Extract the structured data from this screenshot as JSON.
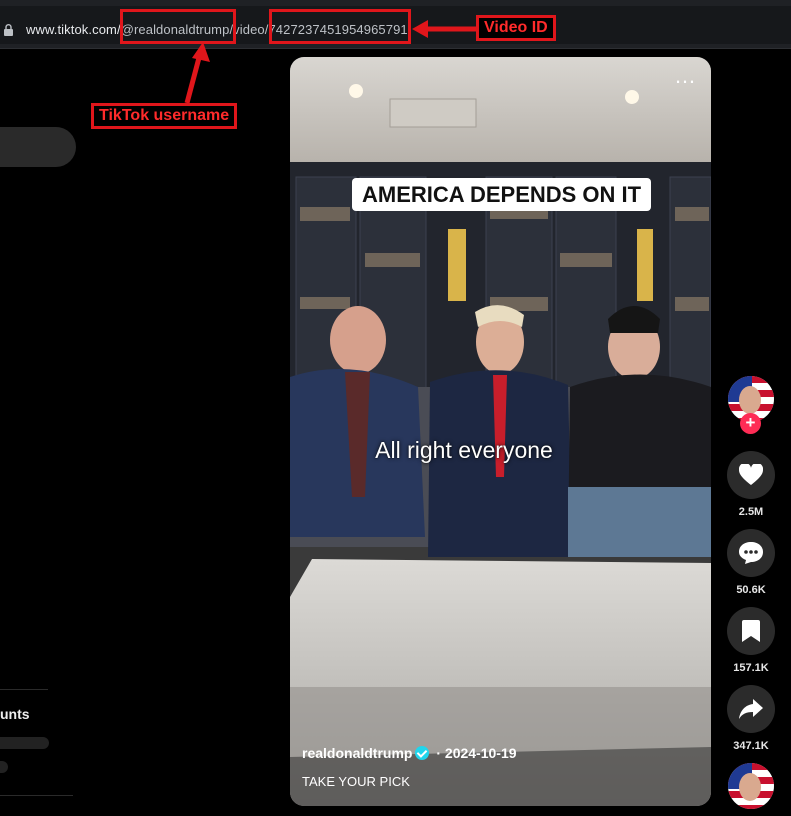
{
  "browser": {
    "url_host": "www.tiktok.com/",
    "url_user": "@realdonaldtrump",
    "url_sep": "/video/",
    "url_id": "7427237451954965791"
  },
  "annotations": {
    "username_label": "TikTok username",
    "video_id_label": "Video ID",
    "color": "#e0161b"
  },
  "sidebar": {
    "accounts_label": "unts"
  },
  "video": {
    "overlay_text": "AMERICA DEPENDS ON IT",
    "subtitle": "All right everyone",
    "author": "realdonaldtrump",
    "date": " · 2024-10-19",
    "description": "TAKE YOUR PICK",
    "more_icon": "ellipsis-icon"
  },
  "actions": {
    "likes": "2.5M",
    "comments": "50.6K",
    "saves": "157.1K",
    "shares": "347.1K"
  },
  "colors": {
    "accent": "#fe2c55",
    "verified": "#20d5ec"
  }
}
